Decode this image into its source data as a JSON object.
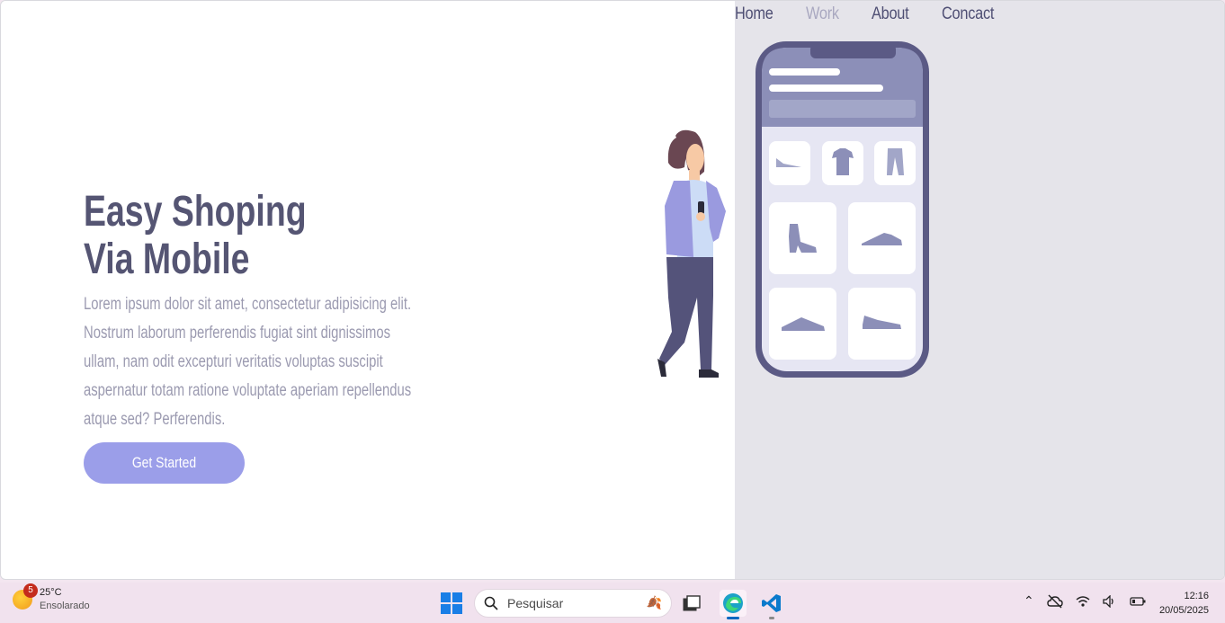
{
  "nav": {
    "items": [
      {
        "label": "Home",
        "active": false
      },
      {
        "label": "Work",
        "active": true
      },
      {
        "label": "About",
        "active": false
      },
      {
        "label": "Concact",
        "active": false
      }
    ]
  },
  "hero": {
    "title_line1": "Easy Shoping",
    "title_line2": "Via Mobile",
    "description": "Lorem ipsum dolor sit amet, consectetur adipisicing elit. Nostrum laborum perferendis fugiat sint dignissimos ullam, nam odit excepturi veritatis voluptas suscipit aspernatur totam ratione voluptate aperiam repellendus atque sed? Perferendis.",
    "cta_label": "Get Started"
  },
  "colors": {
    "title": "#555573",
    "text": "#9b9ab0",
    "accent": "#9b9ee9",
    "panel": "#e5e4ea",
    "phone": "#5b5a85"
  },
  "taskbar": {
    "weather_badge": "5",
    "weather_temp": "25°C",
    "weather_desc": "Ensolarado",
    "search_placeholder": "Pesquisar",
    "time": "12:16",
    "date": "20/05/2025"
  }
}
